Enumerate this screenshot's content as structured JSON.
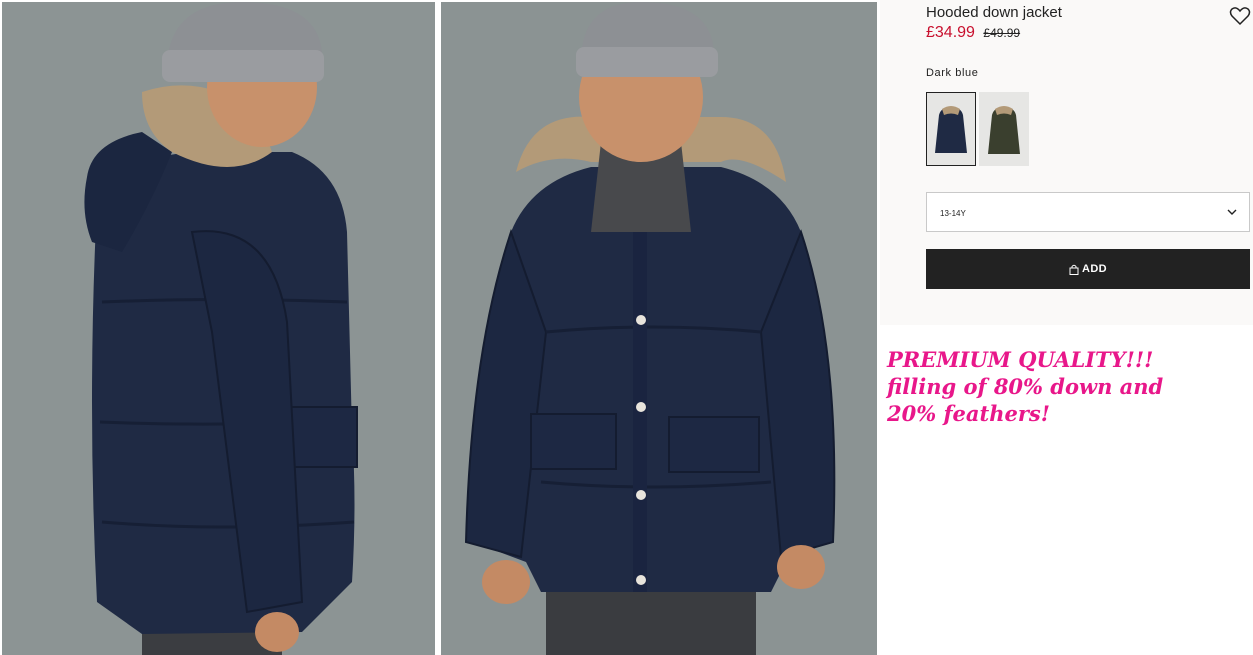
{
  "product": {
    "title": "Hooded down jacket",
    "price_now": "£34.99",
    "price_old": "£49.99",
    "price_color": "#c8102e"
  },
  "colors": {
    "selected_name": "Dark blue",
    "swatches": [
      {
        "name": "dark-blue",
        "hex": "#1f2a44",
        "selected": true
      },
      {
        "name": "dark-khaki",
        "hex": "#3a3f2e",
        "selected": false
      }
    ]
  },
  "size": {
    "selected": "13-14Y"
  },
  "buttons": {
    "add_label": "ADD"
  },
  "promo": {
    "line1": "PREMIUM QUALITY!!!",
    "line2": "filling of 80% down and",
    "line3": "20% feathers!",
    "color": "#e8178a"
  },
  "icons": {
    "favorite": "heart-outline-icon",
    "dropdown": "chevron-down-icon",
    "bag": "shopping-bag-icon"
  },
  "accent": {
    "button_bg": "#222222",
    "panel_bg": "#faf9f8",
    "photo_bg": "#8b9393"
  }
}
